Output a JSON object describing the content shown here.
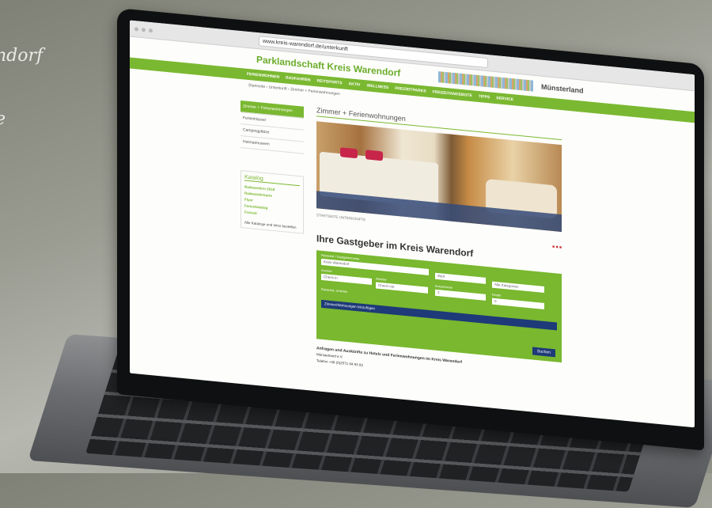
{
  "background_text": [
    "ndorf",
    "e"
  ],
  "browser": {
    "url": "www.kreis-warendorf.de/unterkunft"
  },
  "site": {
    "title": "Parklandschaft Kreis Warendorf",
    "brand": "Münsterland",
    "nav": [
      "FERIENWOHNEN",
      "RADFAHREN",
      "REITSPORTS",
      "AKTIV",
      "WELLNESS",
      "FREIZEITPARKS",
      "FREIZEITANGEBOTE",
      "TIPPS",
      "SERVICE"
    ],
    "breadcrumb": "Startseite › Unterkunft › Zimmer + Ferienwohnungen"
  },
  "sidebar": {
    "items": [
      "Zimmer + Ferienwohnungen",
      "Ferienhäuser",
      "Campingplätze",
      "Heimatmuseen"
    ],
    "katalog_title": "Katalog",
    "katalog_links": [
      "Radwandern 2018",
      "Radwanderkarte",
      "Flyer",
      "Ferienkatalog",
      "Freizeit"
    ],
    "katalog_note": "Alle Kataloge und Infos bestellen"
  },
  "main": {
    "heading": "Zimmer + Ferienwohnungen",
    "tags": "STARTSEITE  UNTERKÜNFTE",
    "host_title": "Ihre Gastgeber im Kreis Warendorf",
    "form": {
      "region_label": "Reiseziel / Gastgebername",
      "region_value": "Kreis Warendorf",
      "anreise_label": "Anreise",
      "anreise_placeholder": "Check-in",
      "abreise_label": "Abreise",
      "abreise_placeholder": "Check-out",
      "sort_value": "Wert",
      "category_value": "Alle Kategorien",
      "guests_label": "Erwachsene",
      "guests_value": "2",
      "children_label": "Kinder",
      "children_value": "0",
      "checkbox_label": "Reiseziel, Umkreis",
      "bar_label": "Zimmer/Wohnungen hinzufügen",
      "search_button": "Suchen"
    },
    "info_title": "Anfragen und Auskünfte zu Hotels und Ferienwohnungen im Kreis Warendorf",
    "info_org": "Münsterland e.V.",
    "info_phone": "Telefon +49 (0)2571 94 93 93"
  }
}
